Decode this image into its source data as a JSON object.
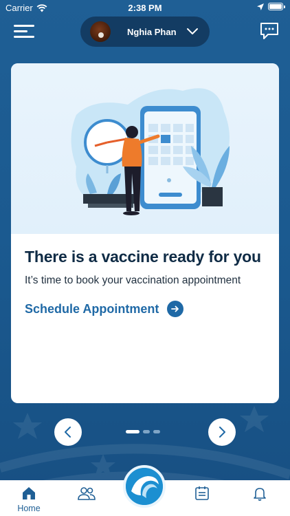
{
  "status_bar": {
    "carrier": "Carrier",
    "time": "2:38 PM"
  },
  "header": {
    "user_name": "Nghia Phan",
    "menu_icon": "hamburger-menu-icon",
    "chat_icon": "chat-bubble-icon"
  },
  "card": {
    "title": "There is a vaccine ready for you",
    "text": "It’s time to book your vaccination appointment",
    "link_label": "Schedule Appointment"
  },
  "carousel": {
    "page_count": 3,
    "active_index": 0
  },
  "tab_bar": {
    "home_label": "Home",
    "active_tab": "home"
  },
  "colors": {
    "background": "#1b5a90",
    "accent": "#1f69a6",
    "title": "#0f2b45",
    "pill": "#133c63",
    "center_button": "#1c8fd1"
  }
}
